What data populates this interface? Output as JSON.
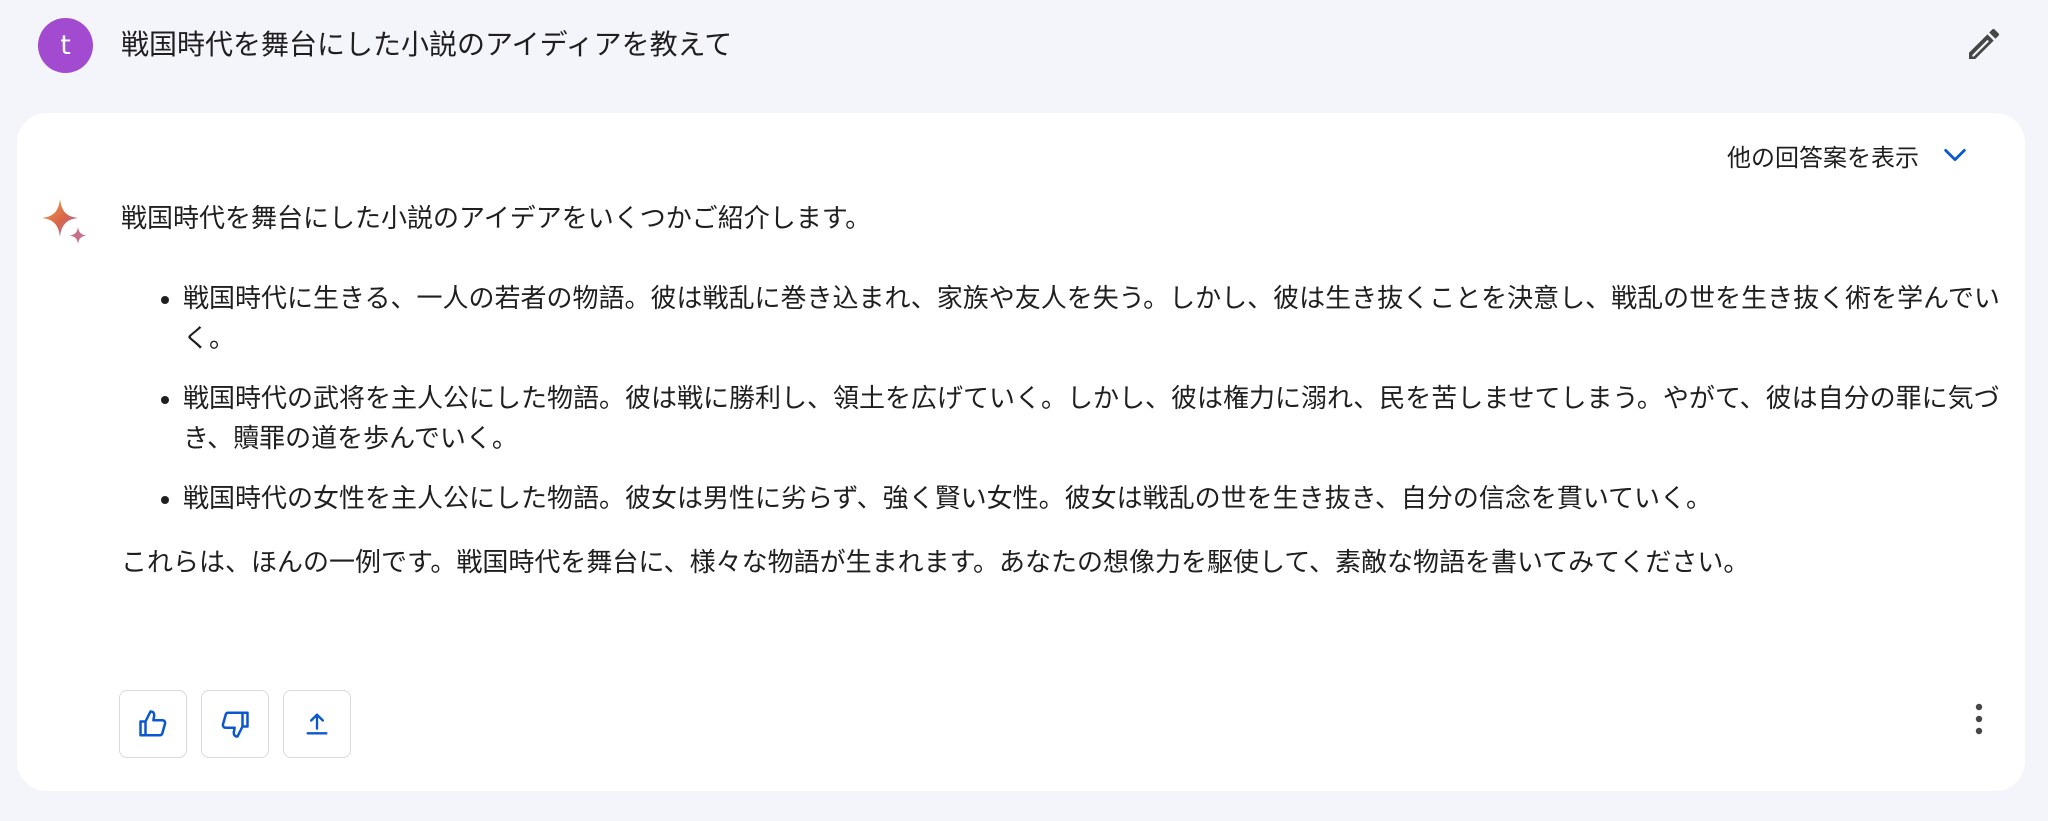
{
  "user": {
    "avatar_letter": "t",
    "avatar_color": "#a24ad0",
    "prompt": "戦国時代を舞台にした小説のアイディアを教えて"
  },
  "header": {
    "edit_icon": "pencil-icon"
  },
  "response": {
    "drafts_label": "他の回答案を表示",
    "drafts_icon": "chevron-down-icon",
    "intro": "戦国時代を舞台にした小説のアイデアをいくつかご紹介します。",
    "bullets": [
      "戦国時代に生きる、一人の若者の物語。彼は戦乱に巻き込まれ、家族や友人を失う。しかし、彼は生き抜くことを決意し、戦乱の世を生き抜く術を学んでいく。",
      "戦国時代の武将を主人公にした物語。彼は戦に勝利し、領土を広げていく。しかし、彼は権力に溺れ、民を苦しませてしまう。やがて、彼は自分の罪に気づき、贖罪の道を歩んでいく。",
      "戦国時代の女性を主人公にした物語。彼女は男性に劣らず、強く賢い女性。彼女は戦乱の世を生き抜き、自分の信念を貫いていく。"
    ],
    "outro": "これらは、ほんの一例です。戦国時代を舞台に、様々な物語が生まれます。あなたの想像力を駆使して、素敵な物語を書いてみてください。"
  },
  "actions": {
    "icons": [
      "thumbs-up-icon",
      "thumbs-down-icon",
      "share-icon",
      "more-vert-icon"
    ],
    "accent": "#0b57d0"
  }
}
